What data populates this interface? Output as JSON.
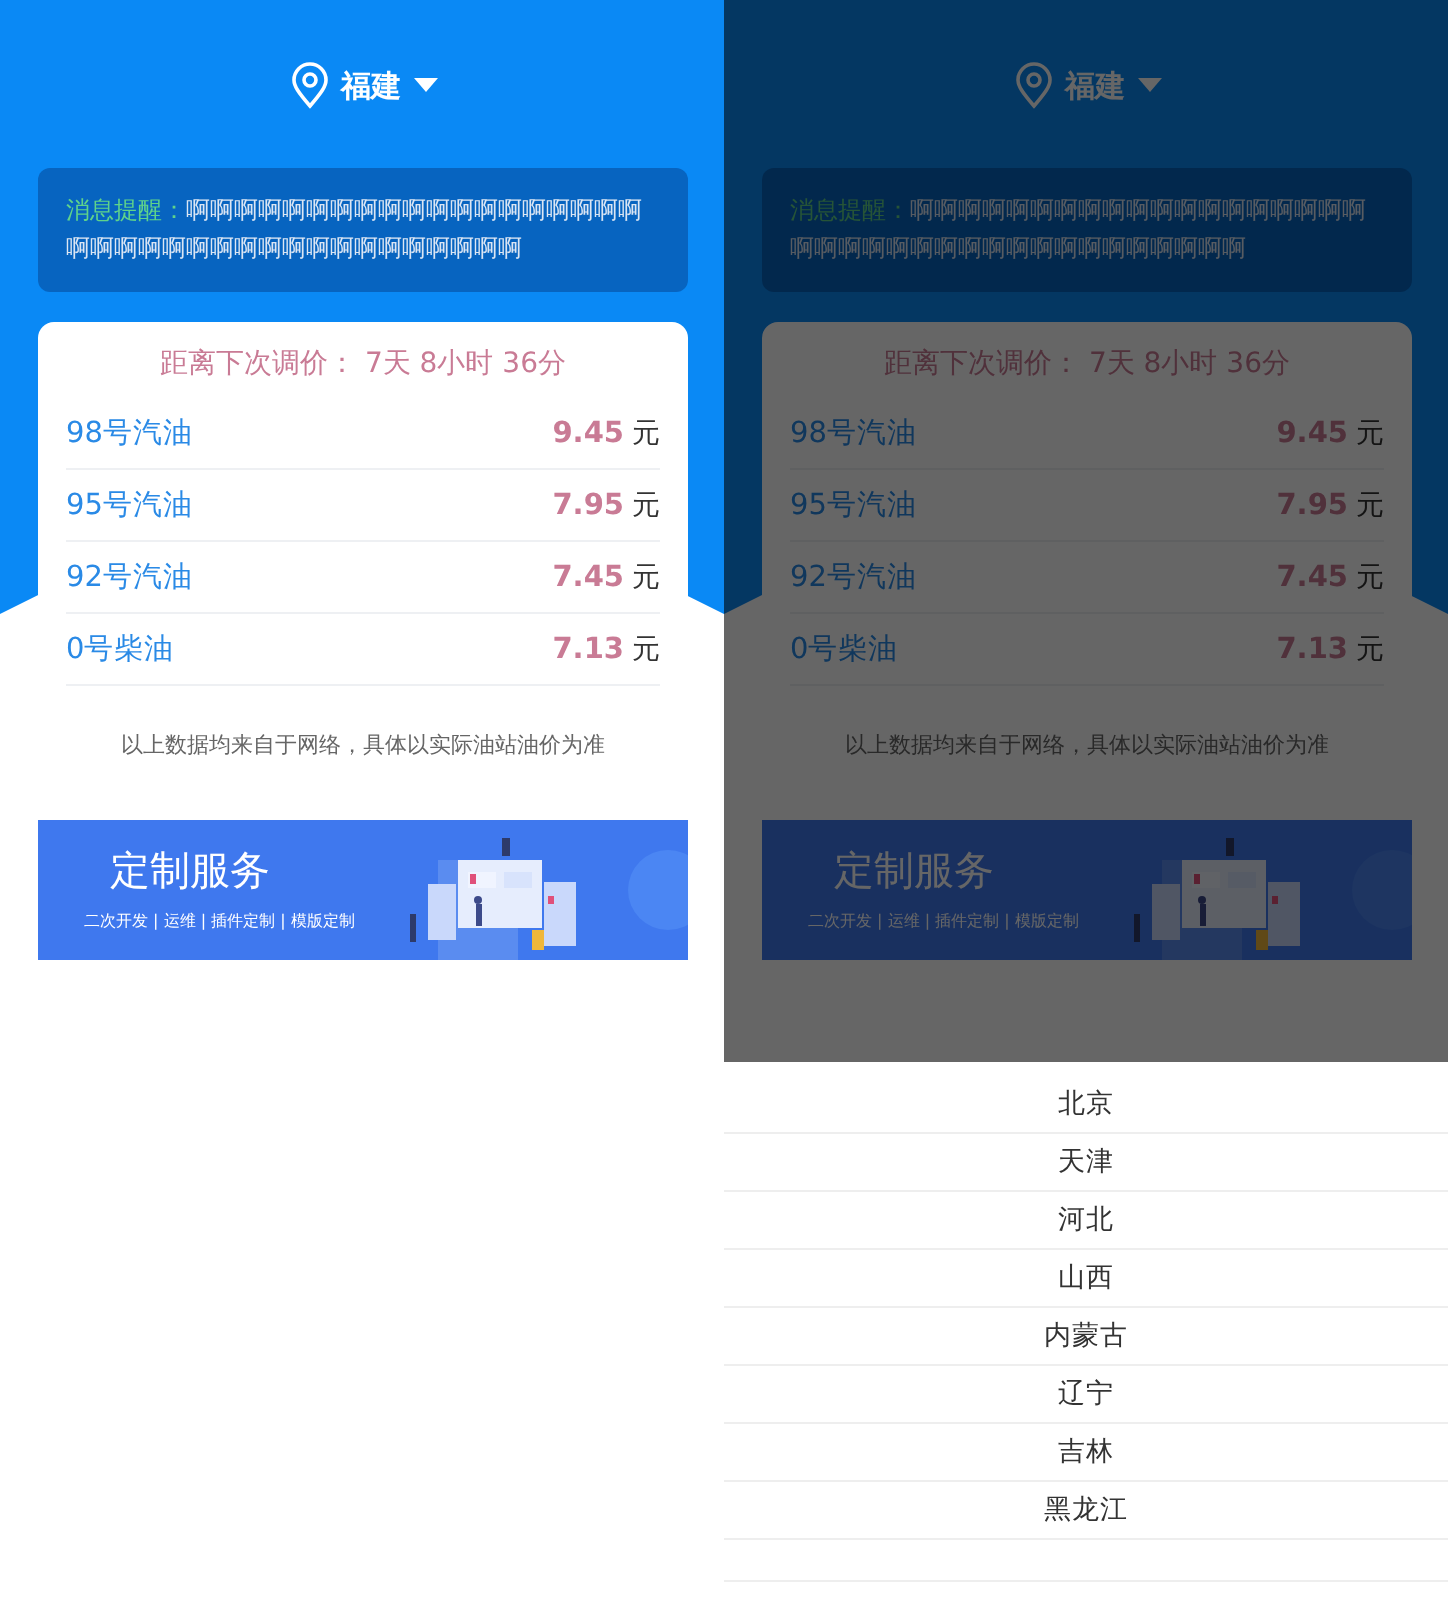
{
  "screens": [
    {
      "location": "福建",
      "notice": {
        "label": "消息提醒：",
        "text": "啊啊啊啊啊啊啊啊啊啊啊啊啊啊啊啊啊啊啊啊啊啊啊啊啊啊啊啊啊啊啊啊啊啊啊啊啊啊"
      },
      "countdown": "距离下次调价： 7天 8小时 36分",
      "prices": [
        {
          "name": "98号汽油",
          "price": "9.45",
          "unit": "元"
        },
        {
          "name": "95号汽油",
          "price": "7.95",
          "unit": "元"
        },
        {
          "name": "92号汽油",
          "price": "7.45",
          "unit": "元"
        },
        {
          "name": "0号柴油",
          "price": "7.13",
          "unit": "元"
        }
      ],
      "footnote": "以上数据均来自于网络，具体以实际油站油价为准",
      "banner": {
        "title": "定制服务",
        "subtitle": "二次开发 | 运维 | 插件定制 | 模版定制"
      },
      "dimmed": false
    },
    {
      "location": "福建",
      "notice": {
        "label": "消息提醒：",
        "text": "啊啊啊啊啊啊啊啊啊啊啊啊啊啊啊啊啊啊啊啊啊啊啊啊啊啊啊啊啊啊啊啊啊啊啊啊啊啊"
      },
      "countdown": "距离下次调价： 7天 8小时 36分",
      "prices": [
        {
          "name": "98号汽油",
          "price": "9.45",
          "unit": "元"
        },
        {
          "name": "95号汽油",
          "price": "7.95",
          "unit": "元"
        },
        {
          "name": "92号汽油",
          "price": "7.45",
          "unit": "元"
        },
        {
          "name": "0号柴油",
          "price": "7.13",
          "unit": "元"
        }
      ],
      "footnote": "以上数据均来自于网络，具体以实际油站油价为准",
      "banner": {
        "title": "定制服务",
        "subtitle": "二次开发 | 运维 | 插件定制 | 模版定制"
      },
      "dimmed": true,
      "picker": [
        "北京",
        "天津",
        "河北",
        "山西",
        "内蒙古",
        "辽宁",
        "吉林",
        "黑龙江"
      ]
    }
  ]
}
